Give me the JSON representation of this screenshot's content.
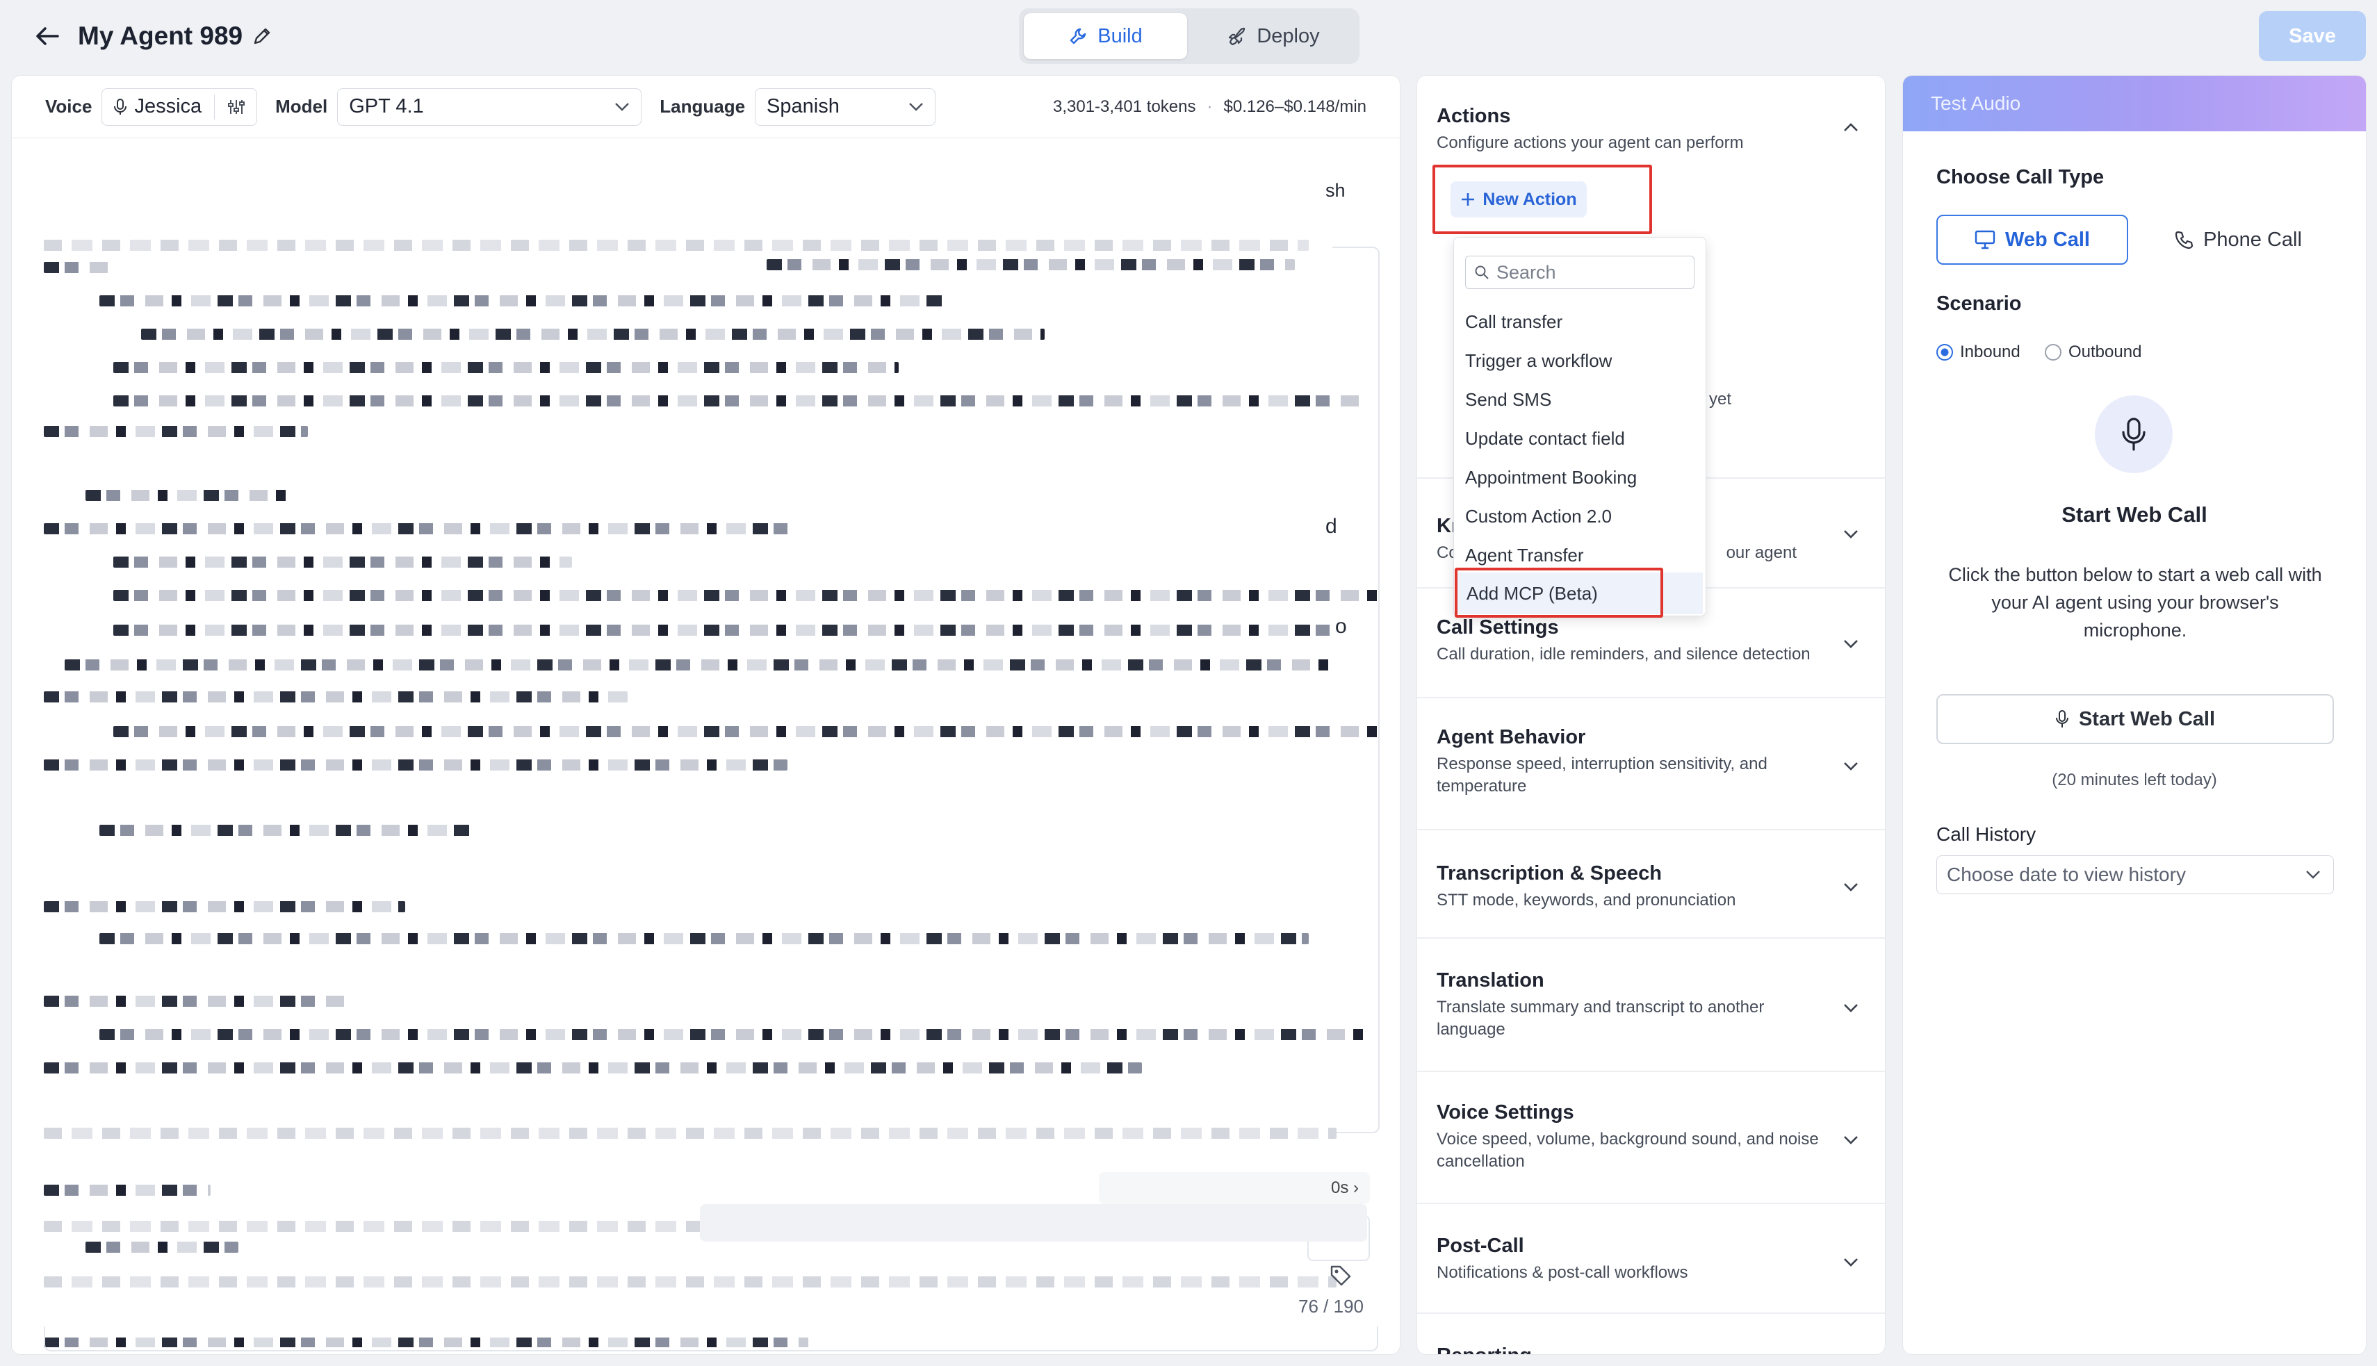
{
  "header": {
    "agent_name": "My Agent 989",
    "tabs": [
      {
        "label": "Build"
      },
      {
        "label": "Deploy"
      }
    ],
    "save_label": "Save"
  },
  "editor": {
    "voice_label": "Voice",
    "voice_value": "Jessica",
    "model_label": "Model",
    "model_value": "GPT 4.1",
    "language_label": "Language",
    "language_value": "Spanish",
    "tokens": "3,301-3,401 tokens",
    "price": "$0.126–$0.148/min",
    "frag_1": "sh",
    "frag_2": "d",
    "frag_3": "o",
    "frag_4": "0s ›",
    "char_count": "76 / 190"
  },
  "settings": {
    "actions_title": "Actions",
    "actions_desc": "Configure actions your agent can perform",
    "new_action_label": "New Action",
    "search_placeholder": "Search",
    "menu_items": [
      "Call transfer",
      "Trigger a workflow",
      "Send SMS",
      "Update contact field",
      "Appointment Booking",
      "Custom Action 2.0",
      "Agent Transfer",
      "Add MCP (Beta)"
    ],
    "partial_yet": "yet",
    "partial_kn": "Kı",
    "partial_co": "Co",
    "partial_agent": "our agent",
    "sections": [
      {
        "title": "Call Settings",
        "desc": "Call duration, idle reminders, and silence detection"
      },
      {
        "title": "Agent Behavior",
        "desc": "Response speed, interruption sensitivity, and temperature"
      },
      {
        "title": "Transcription & Speech",
        "desc": "STT mode, keywords, and pronunciation"
      },
      {
        "title": "Translation",
        "desc": "Translate summary and transcript to another language"
      },
      {
        "title": "Voice Settings",
        "desc": "Voice speed, volume, background sound, and noise cancellation"
      },
      {
        "title": "Post-Call",
        "desc": "Notifications & post-call workflows"
      },
      {
        "title": "Reporting",
        "desc": ""
      }
    ]
  },
  "test": {
    "header": "Test Audio",
    "choose_label": "Choose Call Type",
    "web_call": "Web Call",
    "phone_call": "Phone Call",
    "scenario_label": "Scenario",
    "inbound": "Inbound",
    "outbound": "Outbound",
    "start_title": "Start Web Call",
    "start_desc": "Click the button below to start a web call with your AI agent using your browser's microphone.",
    "start_button": "Start Web Call",
    "minutes_left": "(20 minutes left today)",
    "history_label": "Call History",
    "history_placeholder": "Choose date to view history"
  },
  "colors": {
    "accent": "#2563d9",
    "save_disabled": "#b6d0f8",
    "highlight": "#e0342f"
  }
}
